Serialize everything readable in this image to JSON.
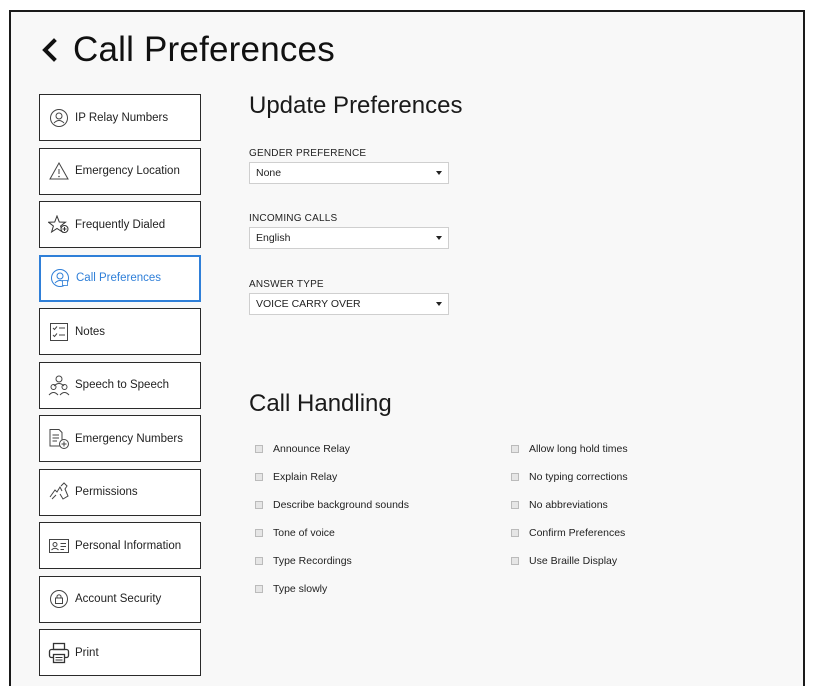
{
  "header": {
    "title": "Call Preferences"
  },
  "sidebar": {
    "items": [
      {
        "label": "IP Relay Numbers"
      },
      {
        "label": "Emergency Location"
      },
      {
        "label": "Frequently Dialed"
      },
      {
        "label": "Call Preferences"
      },
      {
        "label": "Notes"
      },
      {
        "label": "Speech to Speech"
      },
      {
        "label": "Emergency Numbers"
      },
      {
        "label": "Permissions"
      },
      {
        "label": "Personal Information"
      },
      {
        "label": "Account Security"
      },
      {
        "label": "Print"
      }
    ]
  },
  "preferences": {
    "title": "Update Preferences",
    "gender": {
      "label": "GENDER PREFERENCE",
      "value": "None"
    },
    "incoming": {
      "label": "INCOMING CALLS",
      "value": "English"
    },
    "answer": {
      "label": "ANSWER TYPE",
      "value": "VOICE CARRY OVER"
    }
  },
  "handling": {
    "title": "Call Handling",
    "left": [
      "Announce Relay",
      "Explain Relay",
      "Describe background sounds",
      "Tone of voice",
      "Type Recordings",
      "Type slowly"
    ],
    "right": [
      "Allow long hold times",
      "No typing corrections",
      "No abbreviations",
      "Confirm Preferences",
      "Use Braille Display"
    ]
  },
  "colors": {
    "accent": "#2f7fd8",
    "border": "#2a2a2a",
    "background": "#f8f8f8"
  }
}
